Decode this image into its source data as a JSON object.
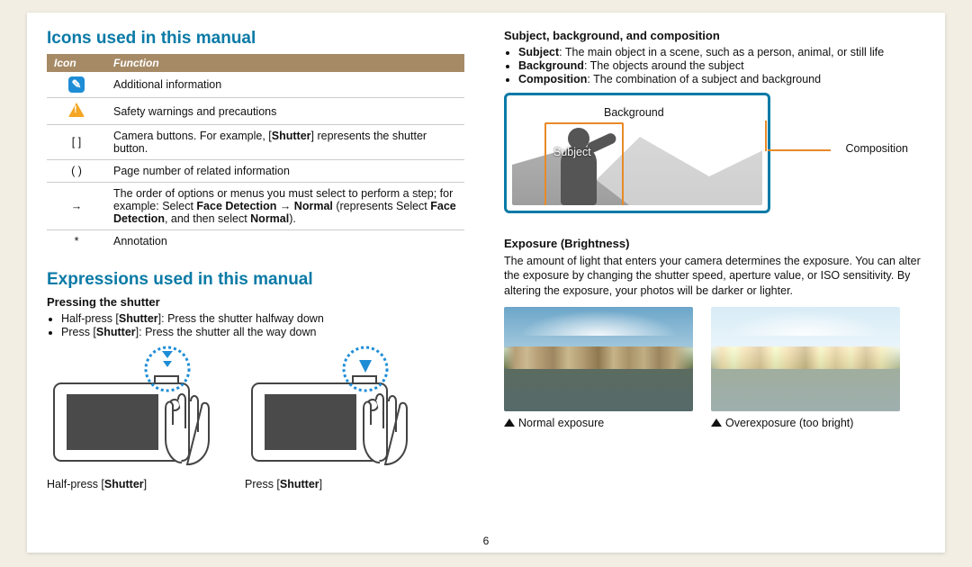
{
  "page_number": "6",
  "left": {
    "h_icons": "Icons used in this manual",
    "th_icon": "Icon",
    "th_func": "Function",
    "rows": {
      "info": "Additional information",
      "warn": "Safety warnings and precautions",
      "bracket_icon": "[  ]",
      "bracket_b1": "Camera buttons. For example, [",
      "bracket_b2": "Shutter",
      "bracket_b3": "] represents the shutter button.",
      "paren_icon": "(  )",
      "paren": "Page number of related information",
      "arrow_icon": "→",
      "arrow_b1": "The order of options or menus you must select to perform a step; for example: Select ",
      "arrow_b2": "Face Detection",
      "arrow_b3": " → ",
      "arrow_b4": "Normal",
      "arrow_b5": " (represents Select ",
      "arrow_b6": "Face Detection",
      "arrow_b7": ", and then select ",
      "arrow_b8": "Normal",
      "arrow_b9": ").",
      "star_icon": "*",
      "star": "Annotation"
    },
    "h_expr": "Expressions used in this manual",
    "sub_press": "Pressing the shutter",
    "li1a": "Half-press [",
    "li1b": "Shutter",
    "li1c": "]: Press the shutter halfway down",
    "li2a": "Press [",
    "li2b": "Shutter",
    "li2c": "]: Press the shutter all the way down",
    "cap1a": "Half-press [",
    "cap1b": "Shutter",
    "cap1c": "]",
    "cap2a": "Press [",
    "cap2b": "Shutter",
    "cap2c": "]"
  },
  "right": {
    "sub_sbc": "Subject, background, and composition",
    "li_s1": "Subject",
    "li_s2": ": The main object in a scene, such as a person, animal, or still life",
    "li_b1": "Background",
    "li_b2": ": The objects around the subject",
    "li_c1": "Composition",
    "li_c2": ": The combination of a subject and background",
    "lbl_bg": "Background",
    "lbl_subj": "Subject",
    "lbl_comp": "Composition",
    "sub_exp": "Exposure (Brightness)",
    "exp_para": "The amount of light that enters your camera determines the exposure. You can alter the exposure by changing the shutter speed, aperture value, or ISO sensitivity. By altering the exposure, your photos will be darker or lighter.",
    "cap_norm": "Normal exposure",
    "cap_over": "Overexposure (too bright)"
  }
}
